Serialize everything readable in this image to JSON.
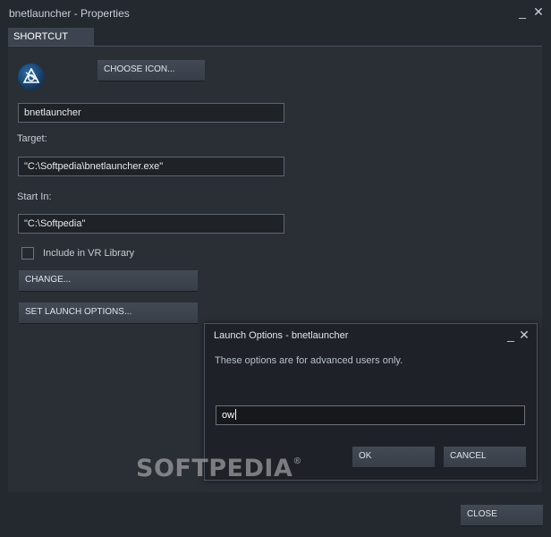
{
  "window": {
    "title": "bnetlauncher - Properties",
    "minimize_glyph": "_",
    "close_glyph": "✕"
  },
  "tab": {
    "label": "SHORTCUT"
  },
  "shortcut": {
    "icon": "game-app-icon",
    "choose_icon_label": "CHOOSE ICON...",
    "name_value": "bnetlauncher",
    "target_label": "Target:",
    "target_value": "\"C:\\Softpedia\\bnetlauncher.exe\"",
    "start_in_label": "Start In:",
    "start_in_value": "\"C:\\Softpedia\"",
    "vr_checkbox_label": "Include in VR Library",
    "vr_checked": false,
    "change_label": "CHANGE...",
    "launch_options_label": "SET LAUNCH OPTIONS..."
  },
  "dialog": {
    "title": "Launch Options - bnetlauncher",
    "minimize_glyph": "_",
    "close_glyph": "✕",
    "message": "These options are for advanced users only.",
    "input_value": "ow",
    "ok_label": "OK",
    "cancel_label": "CANCEL"
  },
  "footer": {
    "close_label": "CLOSE"
  },
  "watermark": {
    "text": "SOFTPEDIA",
    "mark": "®"
  },
  "colors": {
    "background": "#24282f",
    "panel": "#2a2e35",
    "button": "#3d4450",
    "dialog": "#1e2127"
  }
}
